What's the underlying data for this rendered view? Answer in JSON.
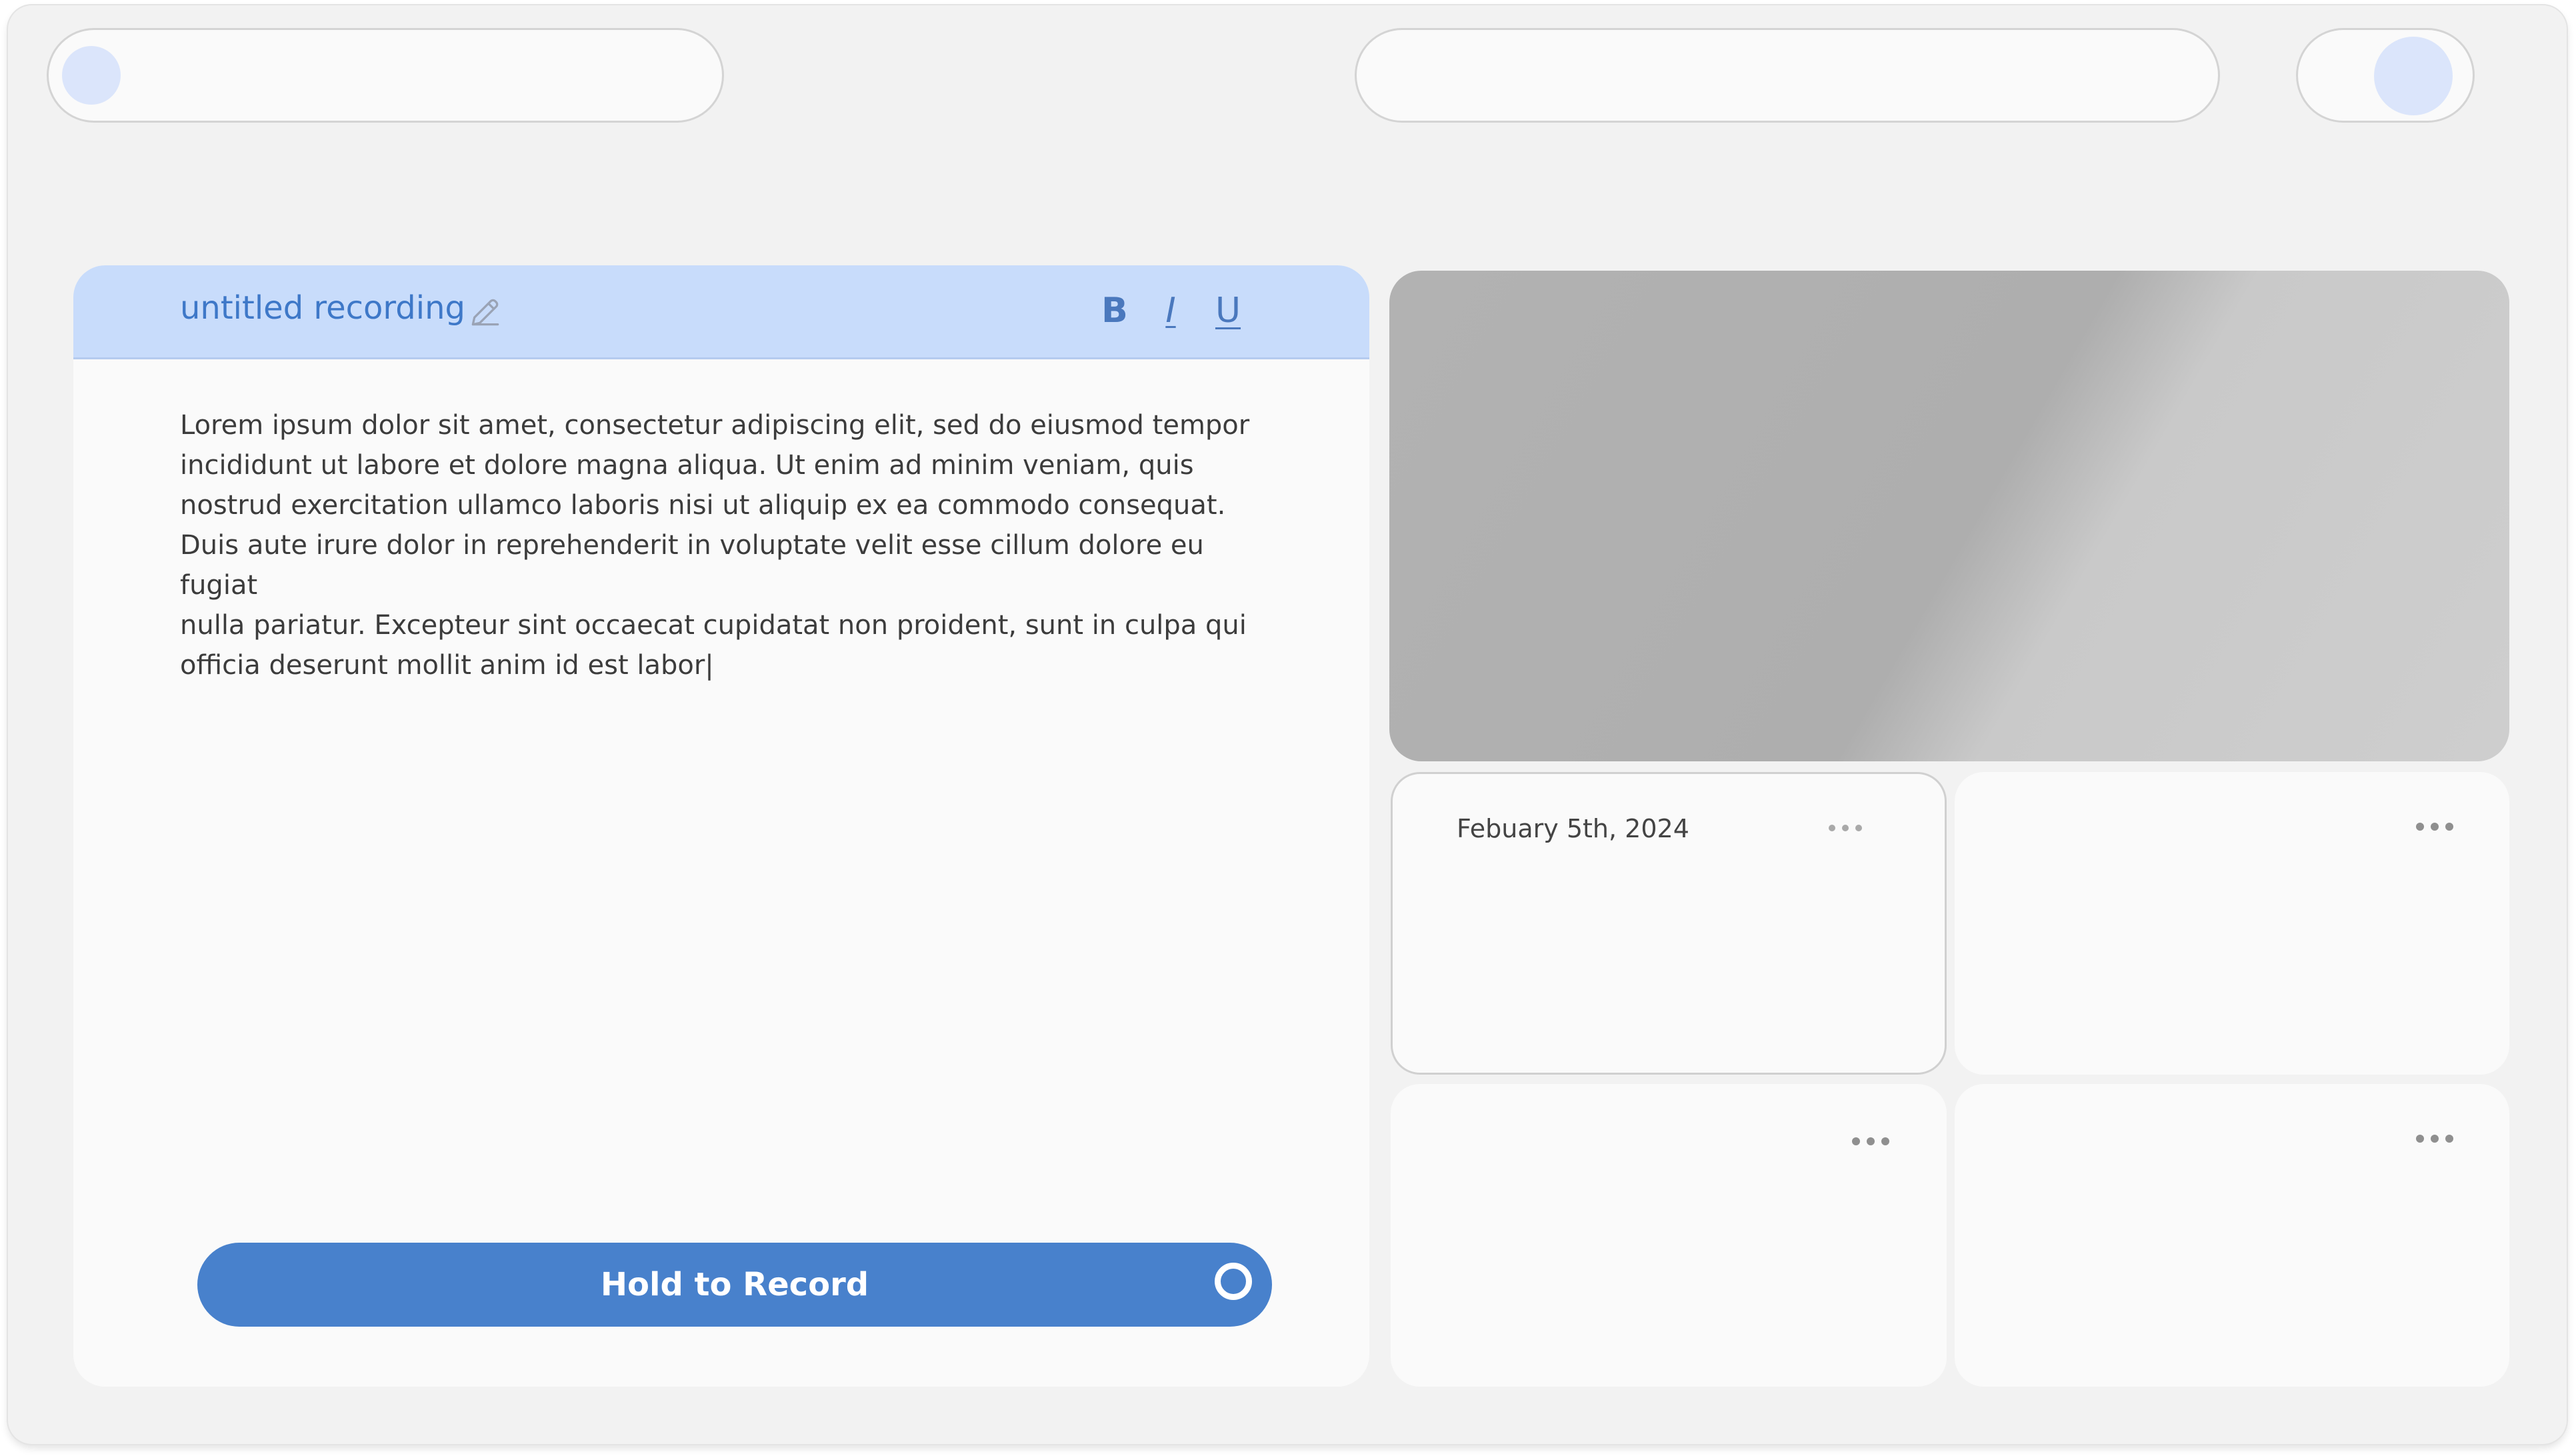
{
  "editor": {
    "title": "untitled recording",
    "format_bold": "B",
    "format_italic": "I",
    "format_underline": "U",
    "body": "Lorem ipsum dolor sit amet, consectetur adipiscing elit, sed do eiusmod tempor\nincididunt ut labore et dolore magna aliqua. Ut enim ad minim veniam, quis\nnostrud exercitation ullamco laboris nisi ut aliquip ex ea commodo consequat.\nDuis aute irure dolor in reprehenderit in voluptate velit esse cillum dolore eu fugiat\nnulla pariatur. Excepteur sint occaecat cupidatat non proident, sunt in culpa qui\nofficia deserunt mollit anim id est labor|",
    "record_label": "Hold to Record"
  },
  "cards": [
    {
      "date": "Febuary 5th, 2024",
      "menu_icon": "more-horizontal-icon"
    },
    {
      "date": "",
      "menu_icon": "more-horizontal-icon"
    },
    {
      "date": "",
      "menu_icon": "more-horizontal-icon"
    },
    {
      "date": "",
      "menu_icon": "more-horizontal-icon"
    }
  ],
  "colors": {
    "accent": "#4881cc",
    "header_bg": "#c8dcfb",
    "title_text": "#3e78c8",
    "window_bg": "#f2f2f2",
    "panel_bg": "#fafafa"
  }
}
